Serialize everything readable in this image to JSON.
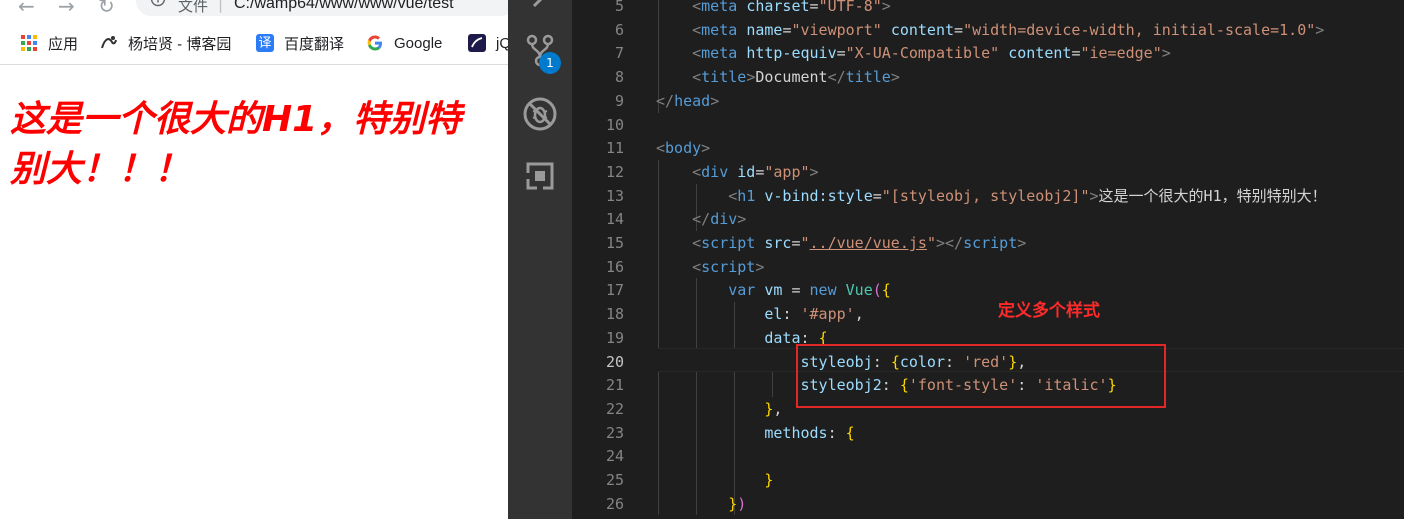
{
  "browser": {
    "address": {
      "prefix": "文件",
      "separator": "|",
      "url": "C:/wamp64/www/www/vue/test"
    },
    "bookmarks": [
      {
        "label": "应用",
        "icon": "apps-grid-icon"
      },
      {
        "label": "杨培贤 - 博客园",
        "icon": "blog-logo-icon"
      },
      {
        "label": "百度翻译",
        "icon": "translate-icon"
      },
      {
        "label": "Google",
        "icon": "google-icon"
      },
      {
        "label": "jQ",
        "icon": "jquery-icon"
      }
    ],
    "page": {
      "h1_line1": "这是一个很大的H1，特别特",
      "h1_line2": "别大！！！",
      "h1_color": "#ff0000"
    }
  },
  "activity_bar": {
    "items": [
      {
        "name": "source-control",
        "icon": "source-control-icon",
        "badge": "1"
      },
      {
        "name": "debug",
        "icon": "debug-icon"
      },
      {
        "name": "extensions",
        "icon": "extensions-icon"
      }
    ]
  },
  "editor": {
    "active_line": 20,
    "line_numbers": [
      "5",
      "6",
      "7",
      "8",
      "9",
      "10",
      "11",
      "12",
      "13",
      "14",
      "15",
      "16",
      "17",
      "18",
      "19",
      "20",
      "21",
      "22",
      "23",
      "24",
      "25",
      "26"
    ],
    "lines": [
      {
        "indent": "    ",
        "tokens": [
          [
            "br",
            "<"
          ],
          [
            "tag",
            "meta"
          ],
          [
            "text",
            " "
          ],
          [
            "attr",
            "charset"
          ],
          [
            "text",
            "="
          ],
          [
            "str",
            "\"UTF-8\""
          ],
          [
            "br",
            ">"
          ]
        ]
      },
      {
        "indent": "    ",
        "tokens": [
          [
            "br",
            "<"
          ],
          [
            "tag",
            "meta"
          ],
          [
            "text",
            " "
          ],
          [
            "attr",
            "name"
          ],
          [
            "text",
            "="
          ],
          [
            "str",
            "\"viewport\""
          ],
          [
            "text",
            " "
          ],
          [
            "attr",
            "content"
          ],
          [
            "text",
            "="
          ],
          [
            "str",
            "\"width=device-width, initial-scale=1.0\""
          ],
          [
            "br",
            ">"
          ]
        ]
      },
      {
        "indent": "    ",
        "tokens": [
          [
            "br",
            "<"
          ],
          [
            "tag",
            "meta"
          ],
          [
            "text",
            " "
          ],
          [
            "attr",
            "http-equiv"
          ],
          [
            "text",
            "="
          ],
          [
            "str",
            "\"X-UA-Compatible\""
          ],
          [
            "text",
            " "
          ],
          [
            "attr",
            "content"
          ],
          [
            "text",
            "="
          ],
          [
            "str",
            "\"ie=edge\""
          ],
          [
            "br",
            ">"
          ]
        ]
      },
      {
        "indent": "    ",
        "tokens": [
          [
            "br",
            "<"
          ],
          [
            "tag",
            "title"
          ],
          [
            "br",
            ">"
          ],
          [
            "text",
            "Document"
          ],
          [
            "br",
            "</"
          ],
          [
            "tag",
            "title"
          ],
          [
            "br",
            ">"
          ]
        ]
      },
      {
        "indent": "",
        "tokens": [
          [
            "br",
            "</"
          ],
          [
            "tag",
            "head"
          ],
          [
            "br",
            ">"
          ]
        ]
      },
      {
        "indent": "",
        "tokens": []
      },
      {
        "indent": "",
        "tokens": [
          [
            "br",
            "<"
          ],
          [
            "tag",
            "body"
          ],
          [
            "br",
            ">"
          ]
        ]
      },
      {
        "indent": "    ",
        "tokens": [
          [
            "br",
            "<"
          ],
          [
            "tag",
            "div"
          ],
          [
            "text",
            " "
          ],
          [
            "attr",
            "id"
          ],
          [
            "text",
            "="
          ],
          [
            "str",
            "\"app\""
          ],
          [
            "br",
            ">"
          ]
        ]
      },
      {
        "indent": "        ",
        "tokens": [
          [
            "br",
            "<"
          ],
          [
            "tag",
            "h1"
          ],
          [
            "text",
            " "
          ],
          [
            "attr",
            "v-bind:style"
          ],
          [
            "text",
            "="
          ],
          [
            "str",
            "\"[styleobj, styleobj2]\""
          ],
          [
            "br",
            ">"
          ],
          [
            "text",
            "这是一个很大的H1，特别特别大！"
          ]
        ]
      },
      {
        "indent": "    ",
        "tokens": [
          [
            "br",
            "</"
          ],
          [
            "tag",
            "div"
          ],
          [
            "br",
            ">"
          ]
        ]
      },
      {
        "indent": "    ",
        "tokens": [
          [
            "br",
            "<"
          ],
          [
            "tag",
            "script"
          ],
          [
            "text",
            " "
          ],
          [
            "attr",
            "src"
          ],
          [
            "text",
            "="
          ],
          [
            "str",
            "\""
          ],
          [
            "strul",
            "../vue/vue.js"
          ],
          [
            "str",
            "\""
          ],
          [
            "br",
            "></"
          ],
          [
            "tag",
            "script"
          ],
          [
            "br",
            ">"
          ]
        ]
      },
      {
        "indent": "    ",
        "tokens": [
          [
            "br",
            "<"
          ],
          [
            "tag",
            "script"
          ],
          [
            "br",
            ">"
          ]
        ]
      },
      {
        "indent": "        ",
        "tokens": [
          [
            "kw",
            "var"
          ],
          [
            "text",
            " "
          ],
          [
            "prop",
            "vm"
          ],
          [
            "text",
            " = "
          ],
          [
            "kw",
            "new"
          ],
          [
            "text",
            " "
          ],
          [
            "fn",
            "Vue"
          ],
          [
            "mag",
            "("
          ],
          [
            "gold",
            "{"
          ]
        ]
      },
      {
        "indent": "            ",
        "tokens": [
          [
            "prop",
            "el"
          ],
          [
            "text",
            ": "
          ],
          [
            "str",
            "'#app'"
          ],
          [
            "text",
            ","
          ]
        ]
      },
      {
        "indent": "            ",
        "tokens": [
          [
            "prop",
            "data"
          ],
          [
            "text",
            ": "
          ],
          [
            "gold",
            "{"
          ]
        ]
      },
      {
        "indent": "                ",
        "tokens": [
          [
            "prop",
            "styleobj"
          ],
          [
            "text",
            ": "
          ],
          [
            "gold",
            "{"
          ],
          [
            "prop",
            "color"
          ],
          [
            "text",
            ": "
          ],
          [
            "str",
            "'red'"
          ],
          [
            "gold",
            "}"
          ],
          [
            "text",
            ","
          ]
        ]
      },
      {
        "indent": "                ",
        "tokens": [
          [
            "prop",
            "styleobj2"
          ],
          [
            "text",
            ": "
          ],
          [
            "gold",
            "{"
          ],
          [
            "str",
            "'font-style'"
          ],
          [
            "text",
            ": "
          ],
          [
            "str",
            "'italic'"
          ],
          [
            "gold",
            "}"
          ]
        ]
      },
      {
        "indent": "            ",
        "tokens": [
          [
            "gold",
            "}"
          ],
          [
            "text",
            ","
          ]
        ]
      },
      {
        "indent": "            ",
        "tokens": [
          [
            "prop",
            "methods"
          ],
          [
            "text",
            ": "
          ],
          [
            "gold",
            "{"
          ]
        ]
      },
      {
        "indent": "",
        "tokens": []
      },
      {
        "indent": "            ",
        "tokens": [
          [
            "gold",
            "}"
          ]
        ]
      },
      {
        "indent": "        ",
        "tokens": [
          [
            "gold",
            "}"
          ],
          [
            "mag",
            ")"
          ]
        ]
      }
    ],
    "annotation": {
      "label": "定义多个样式",
      "color": "#e32626"
    }
  }
}
